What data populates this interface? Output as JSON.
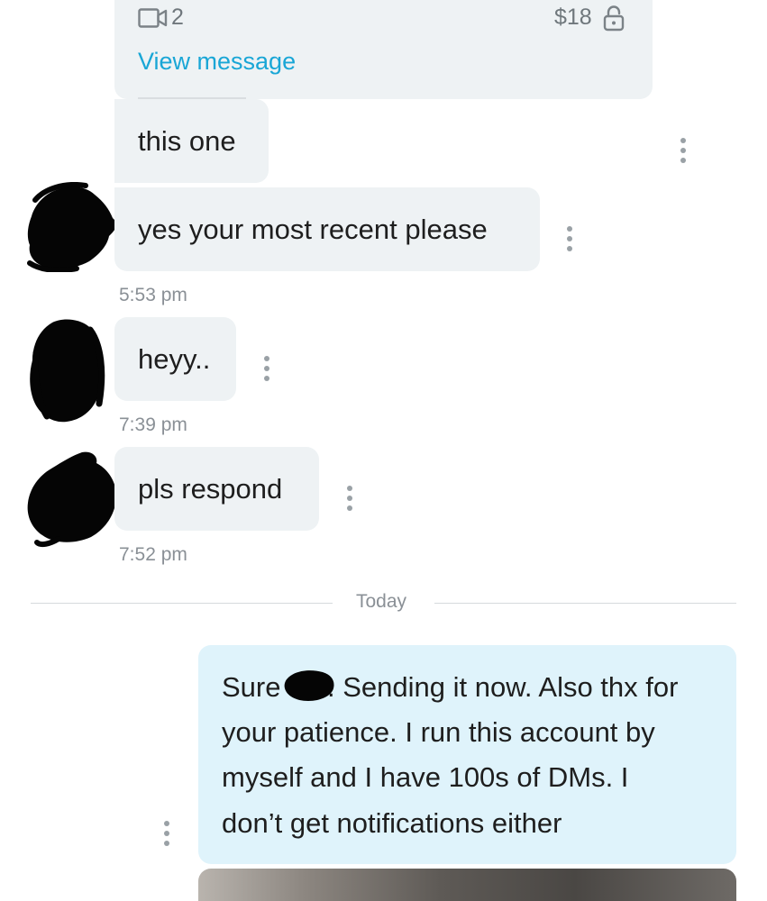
{
  "locked_post": {
    "media_count": "2",
    "price": "$18",
    "view_label": "View message"
  },
  "messages": [
    {
      "text": "this one"
    },
    {
      "text": "yes your most recent please",
      "time": "5:53 pm"
    },
    {
      "text": "heyy..",
      "time": "7:39 pm"
    },
    {
      "text": "pls respond",
      "time": "7:52 pm"
    }
  ],
  "divider": {
    "label": "Today"
  },
  "outgoing": {
    "lines": [
      "Sure",
      ". Sending it now. Also thx for",
      "your patience. I run this account by",
      "myself and I have 100s of DMs. I",
      "don’t get notifications either"
    ]
  },
  "colors": {
    "link": "#19a6d6",
    "incoming_bubble": "#eef2f4",
    "outgoing_bubble": "#dff3fb",
    "timestamp": "#8a9096"
  }
}
